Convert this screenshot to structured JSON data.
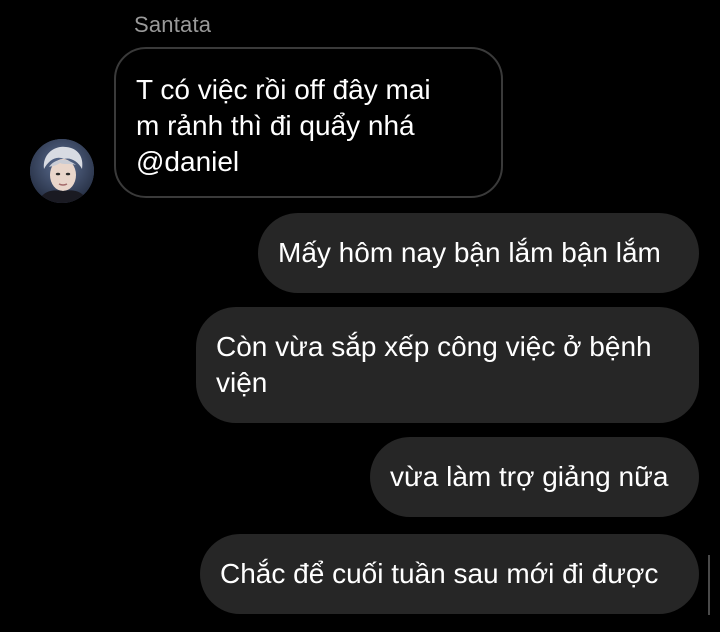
{
  "sender": {
    "name": "Santata",
    "avatar_icon": "user-avatar-photo"
  },
  "messages": [
    {
      "direction": "incoming",
      "lines": [
        "T có việc rồi off đây mai",
        "m rảnh thì đi quẩy nhá",
        "@daniel"
      ]
    },
    {
      "direction": "outgoing",
      "lines": [
        "Mấy hôm nay bận lắm bận lắm"
      ]
    },
    {
      "direction": "outgoing",
      "lines": [
        "Còn vừa sắp xếp công việc ở bệnh",
        "viện"
      ]
    },
    {
      "direction": "outgoing",
      "lines": [
        "vừa làm trợ giảng nữa"
      ]
    },
    {
      "direction": "outgoing",
      "lines": [
        "Chắc để cuối tuần sau mới đi được"
      ]
    }
  ],
  "colors": {
    "background": "#000000",
    "outgoing_bubble": "#262626",
    "incoming_border": "#3a3a3a",
    "sender_name": "#9a9a9a",
    "text": "#ffffff"
  }
}
